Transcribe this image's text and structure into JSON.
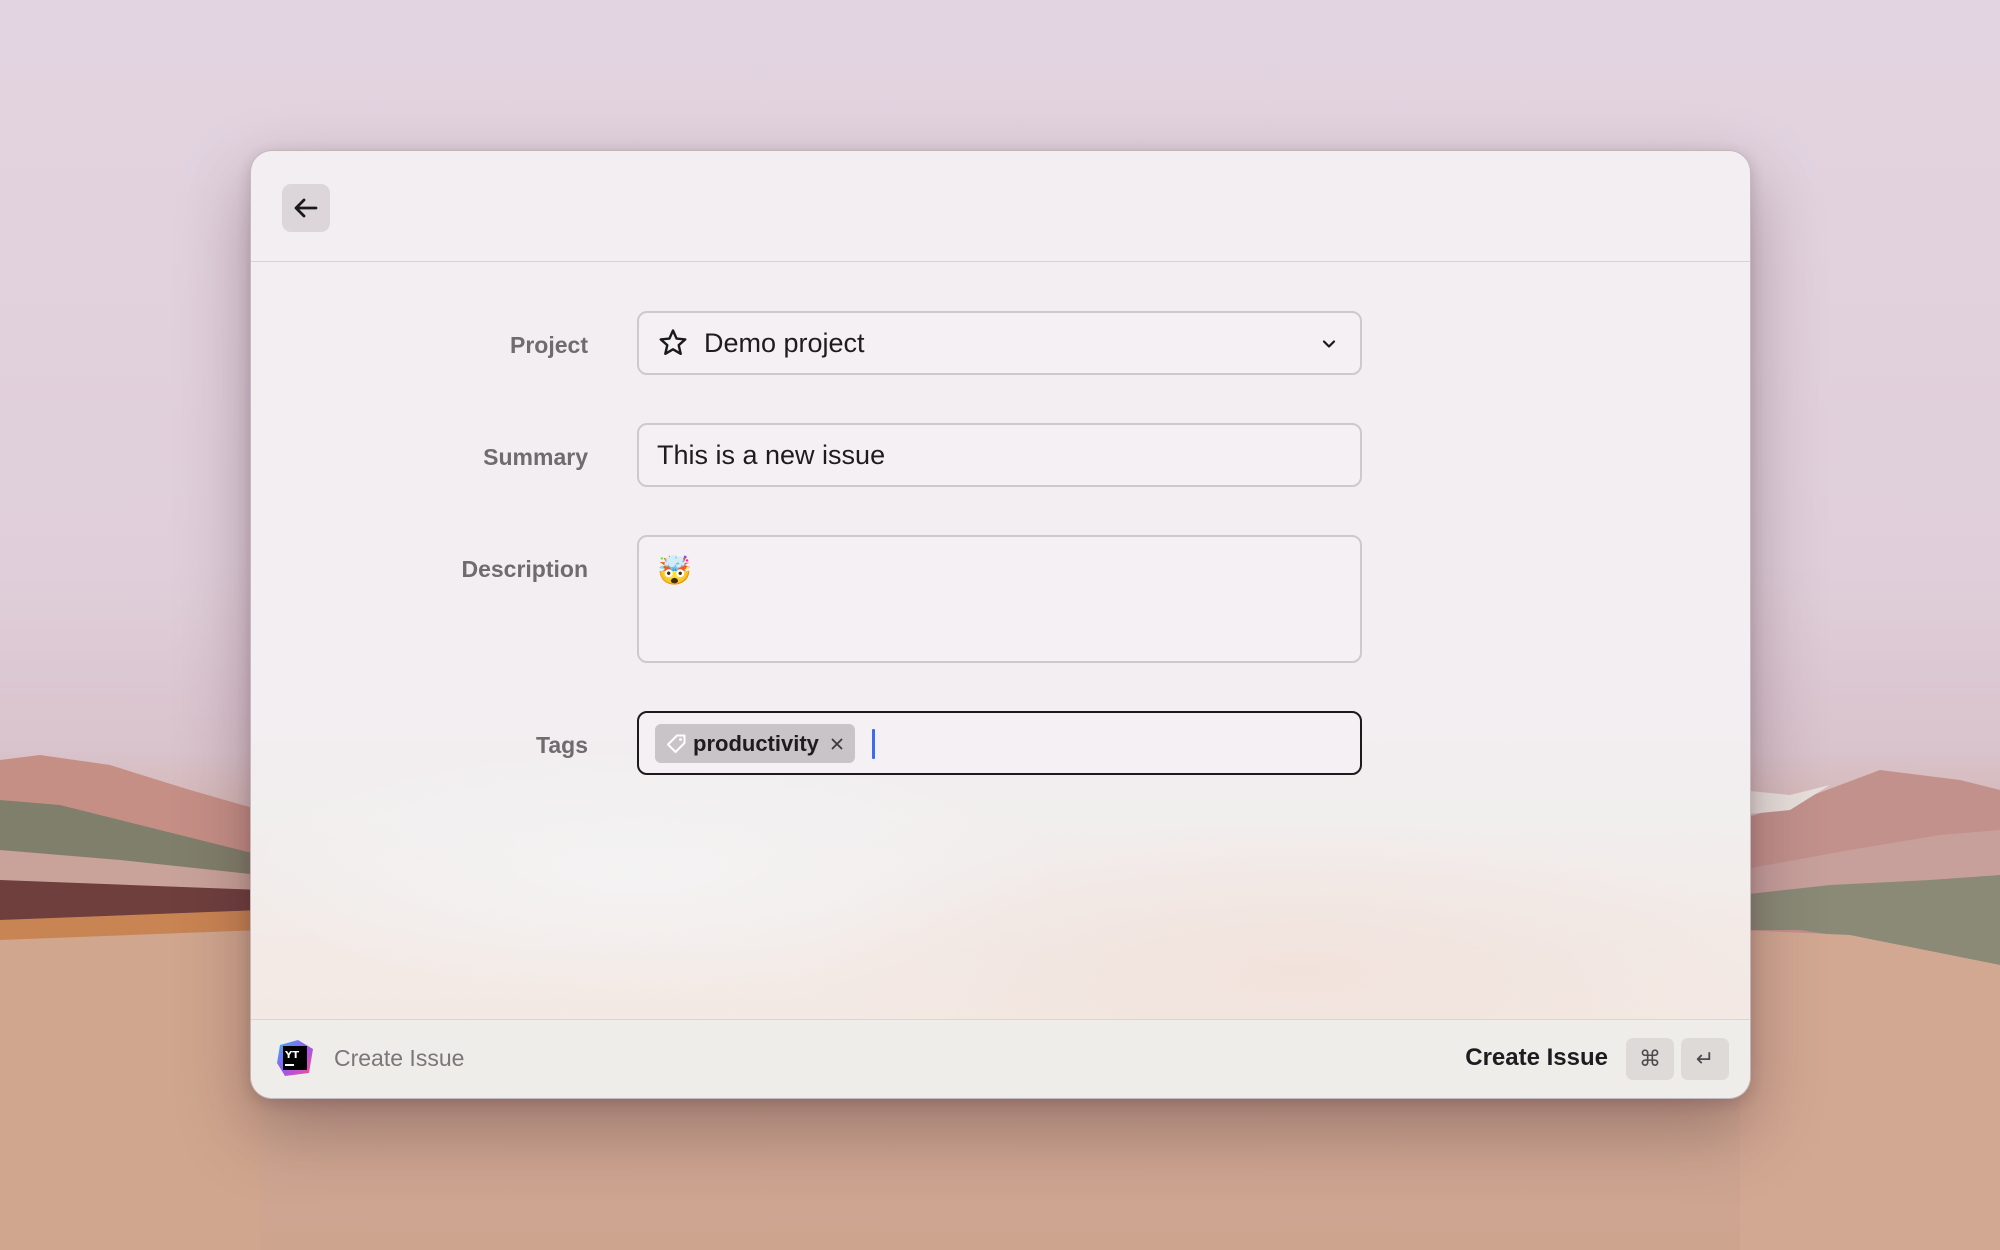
{
  "header": {
    "back_icon": "arrow-left-icon"
  },
  "form": {
    "project": {
      "label": "Project",
      "icon": "star-icon",
      "value": "Demo project",
      "dropdown_icon": "chevron-down-icon"
    },
    "summary": {
      "label": "Summary",
      "value": "This is a new issue"
    },
    "description": {
      "label": "Description",
      "value": "🤯"
    },
    "tags": {
      "label": "Tags",
      "items": [
        {
          "label": "productivity",
          "icon": "tag-icon",
          "remove_icon": "close-icon"
        }
      ]
    }
  },
  "footer": {
    "app_logo": "youtrack-logo",
    "title": "Create Issue",
    "primary_action": "Create Issue",
    "shortcut_keys": [
      "⌘",
      "↵"
    ]
  },
  "colors": {
    "caret": "#3d6bf0",
    "focused_border": "#1b1b1b",
    "field_border": "#cfc9cd"
  }
}
